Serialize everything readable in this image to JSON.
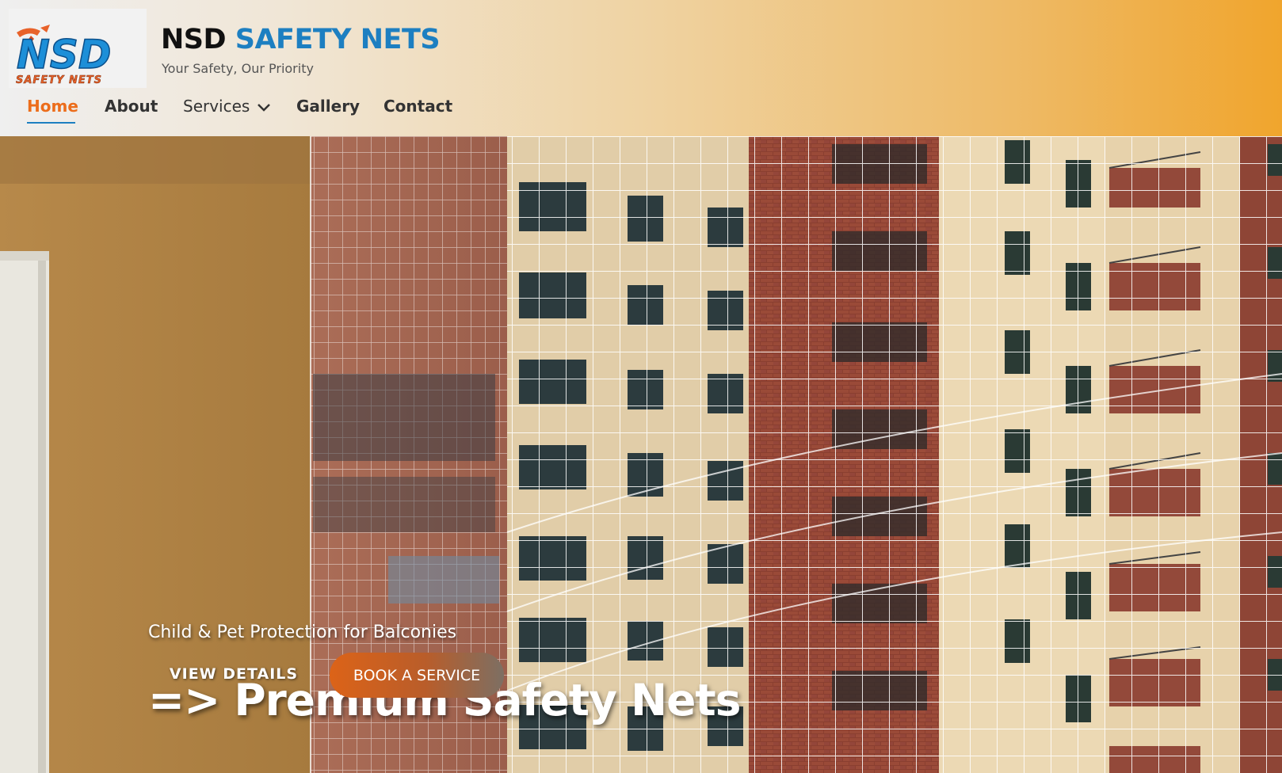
{
  "brand": {
    "logo_text": "NSD",
    "logo_subtext": "SAFETY NETS",
    "title_part1": "NSD",
    "title_part2": "SAFETY NETS",
    "tagline": "Your Safety, Our Priority"
  },
  "nav": {
    "items": [
      {
        "label": "Home",
        "active": true
      },
      {
        "label": "About"
      },
      {
        "label": "Services",
        "icon": "chevron-down-icon"
      },
      {
        "label": "Gallery"
      },
      {
        "label": "Contact"
      }
    ]
  },
  "hero": {
    "arrow": "=>",
    "title": "Premium Safety Nets",
    "subtitle": "Child & Pet Protection for Balconies",
    "view_details_label": "VIEW DETAILS",
    "book_label": "BOOK A SERVICE",
    "image": "apartment-building-with-safety-net"
  },
  "colors": {
    "accent_orange": "#ec6d1b",
    "brand_blue": "#1d7fc1",
    "header_gradient_end": "#f0a52d"
  }
}
